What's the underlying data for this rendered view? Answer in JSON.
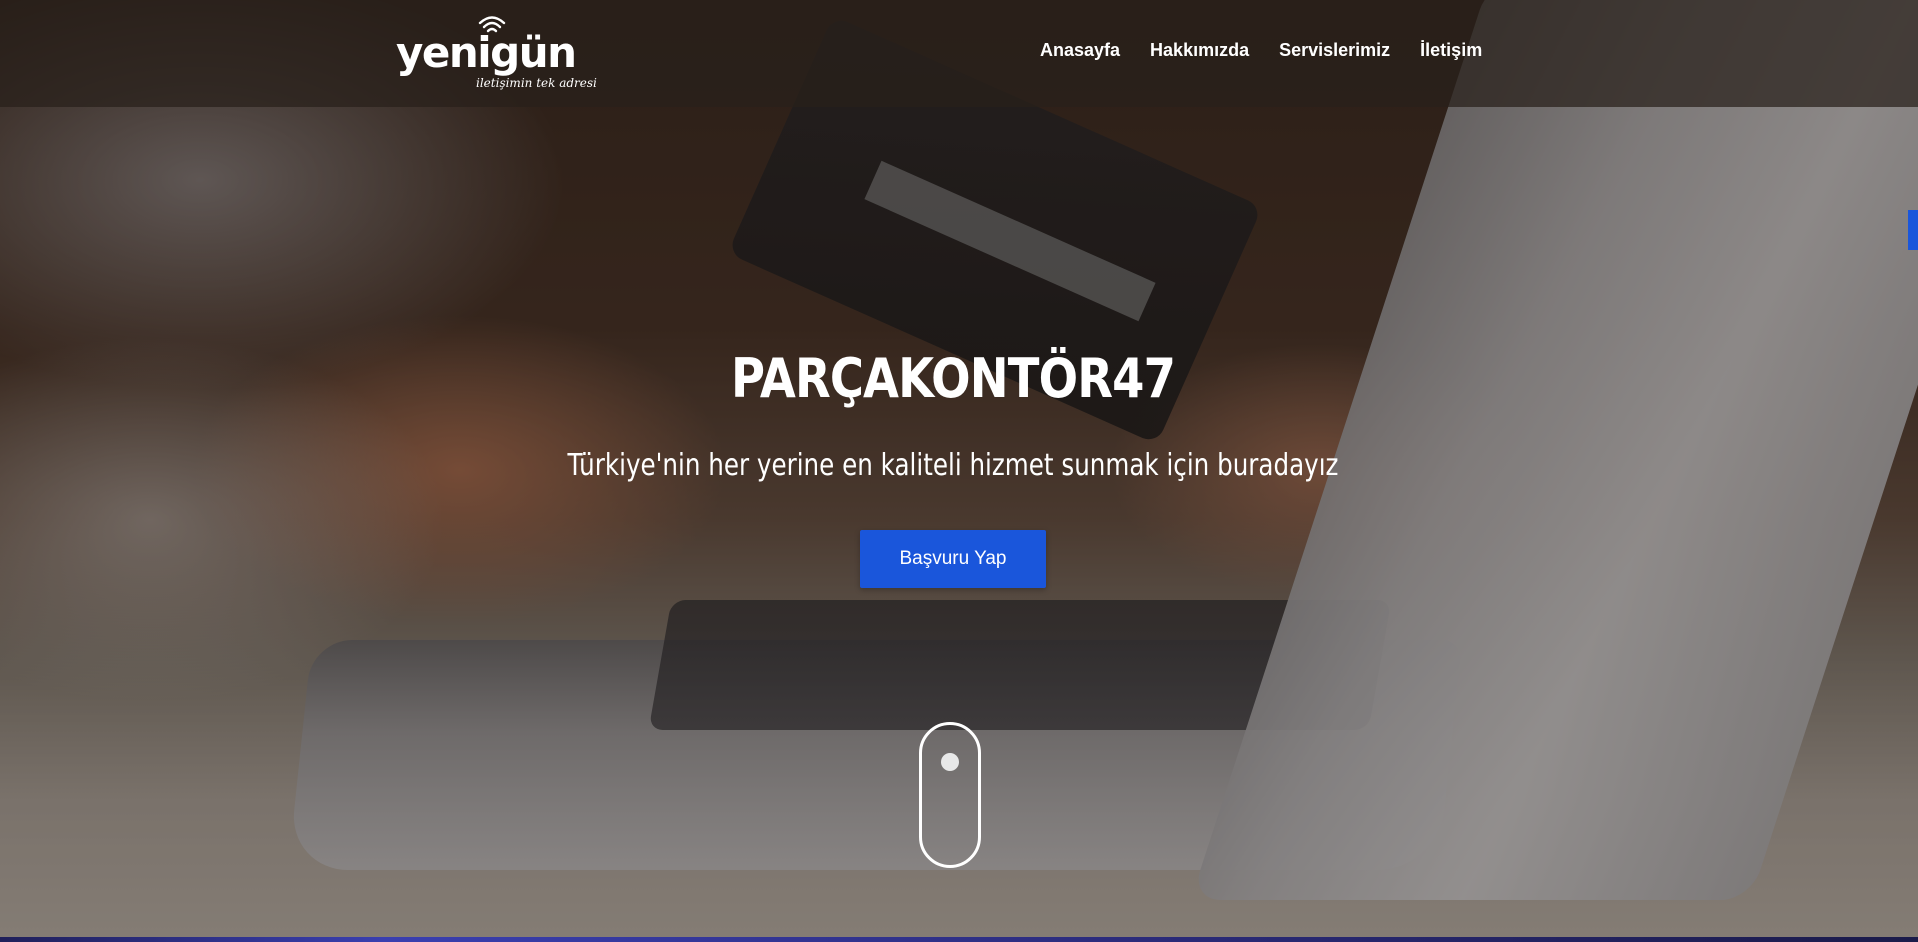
{
  "header": {
    "logo": {
      "wordmark": "yenigün",
      "tagline": "iletişimin tek adresi"
    },
    "nav": [
      {
        "label": "Anasayfa"
      },
      {
        "label": "Hakkımızda"
      },
      {
        "label": "Servislerimiz"
      },
      {
        "label": "İletişim"
      }
    ]
  },
  "hero": {
    "title": "PARÇAKONTÖR47",
    "subtitle": "Türkiye'nin her yerine en kaliteli hizmet sunmak için buradayız",
    "cta_label": "Başvuru Yap",
    "background_image": "hand holding credit card over laptop",
    "scroll_icon": "mouse-scroll-icon"
  },
  "colors": {
    "accent": "#1a56db",
    "text": "#ffffff"
  }
}
